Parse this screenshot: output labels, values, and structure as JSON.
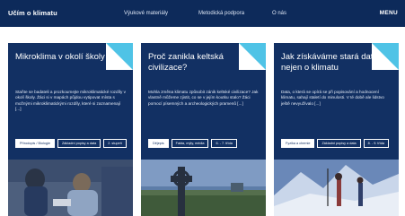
{
  "header": {
    "logo": "Učím o klimatu",
    "nav": [
      "Výukové materiály",
      "Metodická podpora",
      "O nás"
    ],
    "menu_label": "MENU"
  },
  "cards": [
    {
      "title": "Mikroklima v okolí školy",
      "text": "Staňte se badateli a prozkoumejte mikroklimatické rozdíly v okolí školy. Žáci si v mapách půjdou vytipovat místa s možnými mikroklimatickými rozdíly, které si zaznamenají [...]",
      "tags": [
        "Přírodopis / Biologie",
        "Základní popisy a data",
        "2. stupeň"
      ]
    },
    {
      "title": "Proč zanikla keltská civilizace?",
      "text": "Mohla změna klimatu způsobit zánik keltské civilizace? Jak vlastně můžeme zjistit, co se v jejím koutku stalo? Žáci pomocí písemných a archeologických pramenů [...]",
      "tags": [
        "Dějepis",
        "Fakta, mýty, média",
        "6. - 7. třída"
      ]
    },
    {
      "title": "Jak získáváme stará data nejen o klimatu",
      "text": "Data, o která se opírá se při popisování a hodnocení klimatu, sahají staletí do minulosti. V té době ale lidstvo ještě nevyužívalo [...]",
      "tags": [
        "Fyzika a chemie",
        "Základní popisy a data",
        "8. - 9. třída"
      ]
    }
  ],
  "colors": {
    "header_bg": "#0d2a5a",
    "card_bg": "#123063",
    "accent_fold": "#4fc3e6"
  }
}
